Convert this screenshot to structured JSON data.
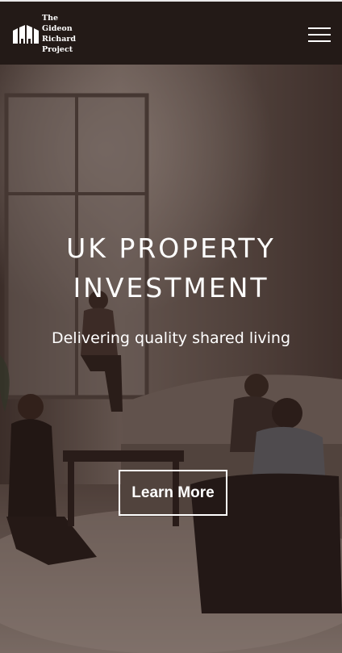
{
  "brand": {
    "logo_lines": [
      "The",
      "Gideon",
      "Richard",
      "Project"
    ],
    "logo_icon": "building-columns-icon"
  },
  "header": {
    "menu_icon": "hamburger-menu-icon"
  },
  "hero": {
    "title_line1": "UK PROPERTY",
    "title_line2": "INVESTMENT",
    "subtitle": "Delivering quality shared living",
    "cta_label": "Learn More"
  },
  "colors": {
    "header_bg": "#231a17",
    "text": "#ffffff",
    "overlay": "rgba(40,25,22,0.42)"
  }
}
